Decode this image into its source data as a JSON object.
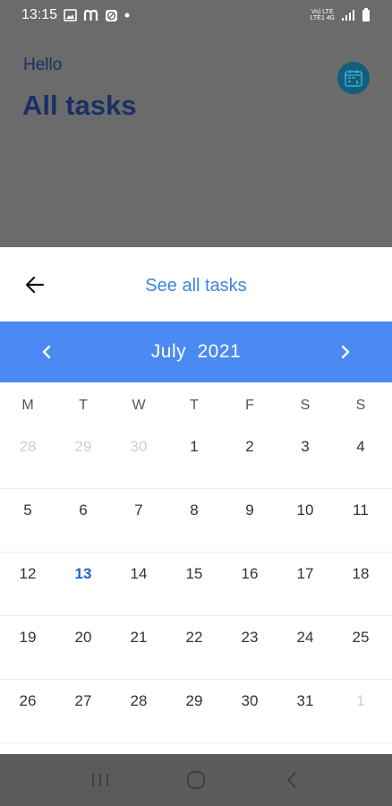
{
  "status_bar": {
    "time": "13:15",
    "icons_left": [
      "gallery-icon",
      "m-app-icon",
      "compass-icon",
      "dot-icon"
    ],
    "network_label_top": "Vo) LTE",
    "network_label_bottom": "LTE1 4G",
    "icons_right": [
      "signal-icon",
      "battery-icon"
    ]
  },
  "header": {
    "greeting": "Hello",
    "title": "All tasks",
    "calendar_icon": "calendar-icon"
  },
  "sheet": {
    "back_icon": "back-arrow-icon",
    "see_all_label": "See all tasks",
    "month_label": "July  2021",
    "prev_icon": "chevron-left-icon",
    "next_icon": "chevron-right-icon",
    "weekdays": [
      "M",
      "T",
      "W",
      "T",
      "F",
      "S",
      "S"
    ],
    "weeks": [
      [
        {
          "d": "28",
          "m": true
        },
        {
          "d": "29",
          "m": true
        },
        {
          "d": "30",
          "m": true
        },
        {
          "d": "1"
        },
        {
          "d": "2"
        },
        {
          "d": "3"
        },
        {
          "d": "4"
        }
      ],
      [
        {
          "d": "5"
        },
        {
          "d": "6"
        },
        {
          "d": "7"
        },
        {
          "d": "8"
        },
        {
          "d": "9"
        },
        {
          "d": "10"
        },
        {
          "d": "11"
        }
      ],
      [
        {
          "d": "12"
        },
        {
          "d": "13",
          "today": true
        },
        {
          "d": "14"
        },
        {
          "d": "15"
        },
        {
          "d": "16"
        },
        {
          "d": "17"
        },
        {
          "d": "18"
        }
      ],
      [
        {
          "d": "19"
        },
        {
          "d": "20"
        },
        {
          "d": "21"
        },
        {
          "d": "22"
        },
        {
          "d": "23"
        },
        {
          "d": "24"
        },
        {
          "d": "25"
        }
      ],
      [
        {
          "d": "26"
        },
        {
          "d": "27"
        },
        {
          "d": "28"
        },
        {
          "d": "29"
        },
        {
          "d": "30"
        },
        {
          "d": "31"
        },
        {
          "d": "1",
          "m": true
        }
      ]
    ]
  },
  "colors": {
    "accent": "#4a8af2",
    "link": "#3f83de",
    "today": "#1f63cf",
    "title": "#1a2f66"
  },
  "nav_bar": {
    "icons": [
      "recents-icon",
      "home-icon",
      "back-icon"
    ]
  }
}
